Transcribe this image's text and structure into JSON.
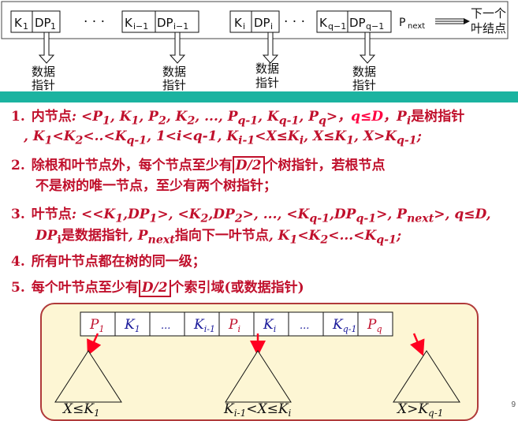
{
  "leaf": {
    "cells": [
      {
        "k": "K",
        "ks": "1",
        "dp": "DP",
        "dps": "1"
      },
      {
        "k": "K",
        "ks": "i−1",
        "dp": "DP",
        "dps": "i−1"
      },
      {
        "k": "K",
        "ks": "i",
        "dp": "DP",
        "dps": "i"
      },
      {
        "k": "K",
        "ks": "q−1",
        "dp": "DP",
        "dps": "q−1"
      }
    ],
    "ellipsis": "· · ·",
    "ellipsis2": "· · ·",
    "pnext": "P",
    "pnext_sub": "next",
    "next_label_1": "下一个",
    "next_label_2": "叶结点",
    "pointer_label_1": "数据",
    "pointer_label_2": "指针"
  },
  "items": [
    {
      "num": "1."
    },
    {
      "num": "2."
    },
    {
      "num": "3."
    },
    {
      "num": "4.",
      "text": "所有叶节点都在树的同一级；"
    },
    {
      "num": "5."
    }
  ],
  "tree": {
    "cells": [
      {
        "base": "P",
        "sub": "1"
      },
      {
        "base": "K",
        "sub": "1"
      },
      {
        "base": "...",
        "sub": ""
      },
      {
        "base": "K",
        "sub": "i-1"
      },
      {
        "base": "P",
        "sub": "i"
      },
      {
        "base": "K",
        "sub": "i"
      },
      {
        "base": "...",
        "sub": ""
      },
      {
        "base": "K",
        "sub": "q-1"
      },
      {
        "base": "P",
        "sub": "q"
      }
    ],
    "labels": [
      "X≤K",
      "1",
      "K",
      "i-1",
      "<X≤K",
      "i",
      "X>K",
      "q-1"
    ]
  },
  "page_number": "9",
  "colors": {
    "accent": "#c0102c",
    "band": "#1bb3a0",
    "panel": "#fdf6d4",
    "navy": "#1a1a9a"
  }
}
